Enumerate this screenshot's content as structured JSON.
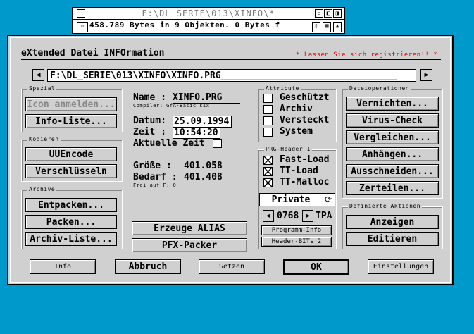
{
  "bg_window": {
    "title": "F:\\DL_SERIE\\013\\XINFO\\*",
    "info": "458.789 Bytes in 9 Objekten. 0 Bytes f"
  },
  "dialog": {
    "title": "eXtended Datei INFOrmation",
    "register_notice": "* Lassen Sie sich registrieren!! *",
    "path": "F:\\DL_SERIE\\013\\XINFO\\XINFO.PRG",
    "path_fill": "________________________________"
  },
  "spezial": {
    "label": "Spezial",
    "icon_button": "Icon anmelden...",
    "info_list_button": "Info-Liste..."
  },
  "kodieren": {
    "label": "Kodieren",
    "uuencode": "UUEncode",
    "encrypt": "Verschlüsseln"
  },
  "archive": {
    "label": "Archive",
    "unpack": "Entpacken...",
    "pack": "Packen...",
    "list": "Archiv-Liste..."
  },
  "fileinfo": {
    "name_label": "Name :",
    "name_value": "XINFO.PRG",
    "compiler": "Compiler: GfA-Basic six",
    "date_label": "Datum:",
    "date_value": "25.09.1994",
    "time_label": "Zeit :",
    "time_value": "10:54:20",
    "current_time_label": "Aktuelle Zeit",
    "size_label": "Größe  :",
    "size_value": "401.058",
    "need_label": "Bedarf :",
    "need_value": "401.408",
    "free_label": "Frei auf F: 0",
    "alias_button": "Erzeuge ALIAS",
    "pfx_button": "PFX-Packer"
  },
  "attributes": {
    "label": "Attribute",
    "items": [
      {
        "label": "Geschützt",
        "checked": false
      },
      {
        "label": "Archiv",
        "checked": false
      },
      {
        "label": "Versteckt",
        "checked": false
      },
      {
        "label": "System",
        "checked": false
      }
    ]
  },
  "prg_header": {
    "label": "PRG-Header 1",
    "items": [
      {
        "label": "Fast-Load",
        "checked": true
      },
      {
        "label": "TT-Load",
        "checked": true
      },
      {
        "label": "TT-Malloc",
        "checked": true
      }
    ],
    "mode": "Private",
    "tpa_value": "0768",
    "tpa_label": "TPA",
    "program_info_button": "Programm-Info",
    "header_bits_button": "Header-BITs 2"
  },
  "fileops": {
    "label": "Dateioperationen",
    "buttons": [
      "Vernichten...",
      "Virus-Check",
      "Vergleichen...",
      "Anhängen...",
      "Ausschneiden...",
      "Zerteilen..."
    ]
  },
  "defined_actions": {
    "label": "Definierte Aktionen",
    "buttons": [
      "Anzeigen",
      "Editieren"
    ]
  },
  "bottom": {
    "info": "Info",
    "cancel": "Abbruch",
    "set": "Setzen",
    "ok": "OK",
    "settings": "Einstellungen"
  },
  "colors": {
    "desktop": "#0099cc",
    "dialog": "#d0d0d0",
    "notice": "#e00000"
  }
}
